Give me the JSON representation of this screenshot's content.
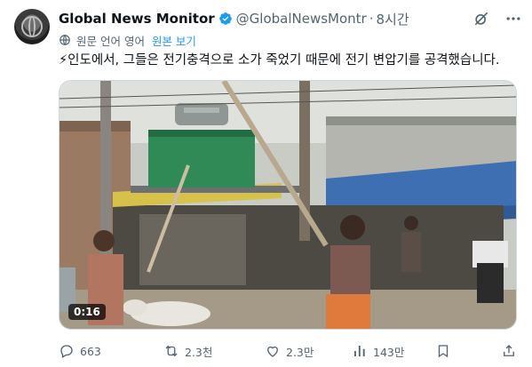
{
  "author": {
    "name": "Global News Monitor",
    "handle": "@GlobalNewsMontr",
    "separator": "·",
    "time": "8시간"
  },
  "translation": {
    "original_language": "원문 언어 영어",
    "show_original": "원본 보기"
  },
  "tweet": {
    "text": "⚡인도에서, 그들은 전기충격으로 소가 죽었기 때문에 전기 변압기를 공격했습니다."
  },
  "media": {
    "duration": "0:16"
  },
  "actions": {
    "replies": "663",
    "retweets": "2.3천",
    "likes": "2.3만",
    "views": "143만"
  },
  "colors": {
    "accent": "#1d9bf0",
    "muted": "#536471",
    "verified": "#1d9bf0"
  },
  "icons": [
    "grok-icon",
    "more-icon",
    "globe-icon",
    "reply-icon",
    "retweet-icon",
    "like-icon",
    "views-icon",
    "bookmark-icon",
    "share-icon"
  ]
}
